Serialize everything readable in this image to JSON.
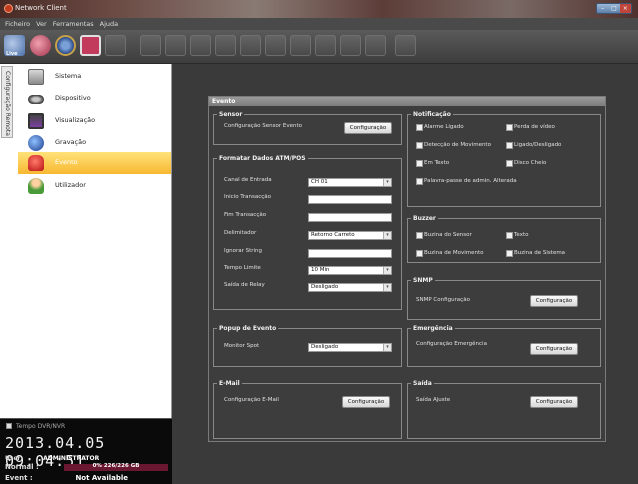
{
  "window": {
    "title": "Network Client"
  },
  "menu": [
    "Ficheiro",
    "Ver",
    "Ferramentas",
    "Ajuda"
  ],
  "toolbar": {
    "live_label": "Live"
  },
  "sidebar": {
    "vertical_tab": "Configuração Remota",
    "items": [
      {
        "label": "Sistema",
        "icon": "system-icon"
      },
      {
        "label": "Dispositivo",
        "icon": "device-icon"
      },
      {
        "label": "Visualização",
        "icon": "display-icon"
      },
      {
        "label": "Gravação",
        "icon": "record-icon"
      },
      {
        "label": "Evento",
        "icon": "event-icon",
        "active": true
      },
      {
        "label": "Utilizador",
        "icon": "user-icon"
      }
    ]
  },
  "status": {
    "title": "Tempo DVR/NVR",
    "clock": "2013.04.05 09:04:51",
    "user_key": "User",
    "user_value": "ADMINISTRATOR",
    "normal_key": "Normal :",
    "normal_value": "0% 226/226 GB",
    "normal_used_fraction": 0.0,
    "event_key": "Event :",
    "event_value": "Not Available"
  },
  "panel": {
    "title": "Evento",
    "sensor": {
      "title": "Sensor",
      "label": "Configuração Sensor Evento",
      "button": "Configuração"
    },
    "atm": {
      "title": "Formatar Dados ATM/POS",
      "canal_label": "Canal de Entrada",
      "canal_value": "CH 01",
      "inicio_label": "Inicio Transacção",
      "fim_label": "Fim Transacção",
      "delimitador_label": "Delimitador",
      "delimitador_value": "Retorno Carreto",
      "ignorar_label": "Ignorar String",
      "tempo_label": "Tempo Limite",
      "tempo_value": "10 Min",
      "relay_label": "Saída de Relay",
      "relay_value": "Desligado"
    },
    "notificacao": {
      "title": "Notificação",
      "items": [
        "Alarme Ligado",
        "Perda de vídeo",
        "Detecção de Movimento",
        "Ligado/Desligado",
        "Em Texto",
        "Disco Cheio",
        "Palavra-passe de admin. Alterada"
      ]
    },
    "buzzer": {
      "title": "Buzzer",
      "items": [
        "Buzina do Sensor",
        "Texto",
        "Buzina de Movimento",
        "Buzina de Sistema"
      ]
    },
    "snmp": {
      "title": "SNMP",
      "label": "SNMP Configuração",
      "button": "Configuração"
    },
    "popup": {
      "title": "Popup de Evento",
      "label": "Monitor Spot",
      "value": "Desligado"
    },
    "emergencia": {
      "title": "Emergência",
      "label": "Configuração Emergência",
      "button": "Configuração"
    },
    "email": {
      "title": "E-Mail",
      "label": "Configuração E-Mail",
      "button": "Configuração"
    },
    "saida": {
      "title": "Saída",
      "label": "Saída Ajuste",
      "button": "Configuração"
    }
  }
}
